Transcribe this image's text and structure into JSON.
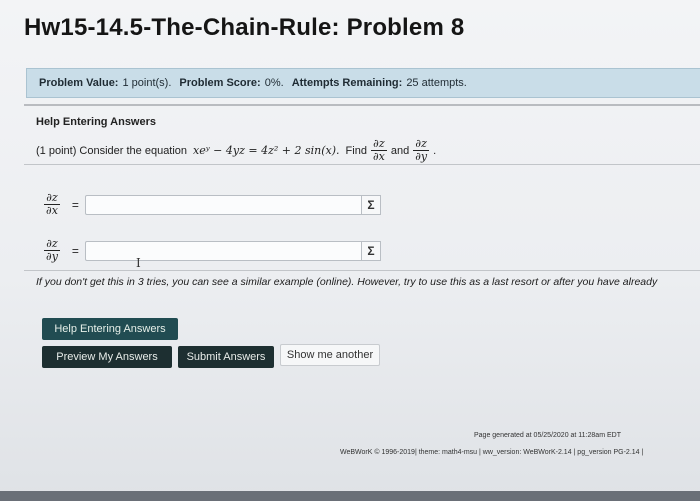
{
  "page": {
    "title": "Hw15-14.5-The-Chain-Rule: Problem 8"
  },
  "info_bar": {
    "problem_value_label": "Problem Value:",
    "problem_value": "1 point(s).",
    "problem_score_label": "Problem Score:",
    "problem_score": "0%.",
    "attempts_label": "Attempts Remaining:",
    "attempts": "25 attempts."
  },
  "problem": {
    "help_heading": "Help Entering Answers",
    "statement_prefix": "(1 point) Consider the equation",
    "equation": "xeʸ − 4yz = 4z² + 2 sin(x).",
    "find_text": "Find",
    "and_text": "and",
    "deriv1_num": "∂z",
    "deriv1_den": "∂x",
    "deriv2_num": "∂z",
    "deriv2_den": "∂y",
    "period": "."
  },
  "answers": [
    {
      "num": "∂z",
      "den": "∂x",
      "eq": "=",
      "value": "",
      "sigma": "Σ"
    },
    {
      "num": "∂z",
      "den": "∂y",
      "eq": "=",
      "value": "",
      "sigma": "Σ"
    }
  ],
  "note": "If you don't get this in 3 tries, you can see a similar example (online). However, try to use this as a last resort or after you have already",
  "buttons": {
    "help_entering": "Help Entering Answers",
    "preview": "Preview My Answers",
    "submit": "Submit Answers",
    "show_another": "Show me another"
  },
  "footer": {
    "generated": "Page generated at 05/25/2020 at 11:28am EDT",
    "webwork": "WeBWorK © 1996-2019| theme: math4-msu | ww_version: WeBWorK-2.14 | pg_version PG-2.14 |"
  },
  "colors": {
    "info_bar_bg": "#c9dde8",
    "dark_button": "#1d2f31",
    "help_button": "#214c52"
  }
}
